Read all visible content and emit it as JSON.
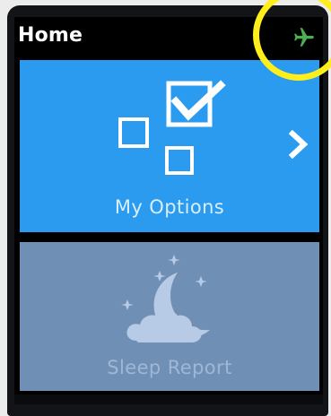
{
  "header": {
    "title": "Home",
    "status_icon": "airplane-mode-icon",
    "status_color": "#4caf50"
  },
  "tiles": [
    {
      "label": "My Options",
      "icon": "checkbox-options-icon",
      "background": "#2a9bee",
      "has_chevron": true
    },
    {
      "label": "Sleep Report",
      "icon": "moon-cloud-stars-icon",
      "background": "#6f8fb5"
    }
  ],
  "annotation": {
    "shape": "circle",
    "color": "#ffee1a"
  }
}
